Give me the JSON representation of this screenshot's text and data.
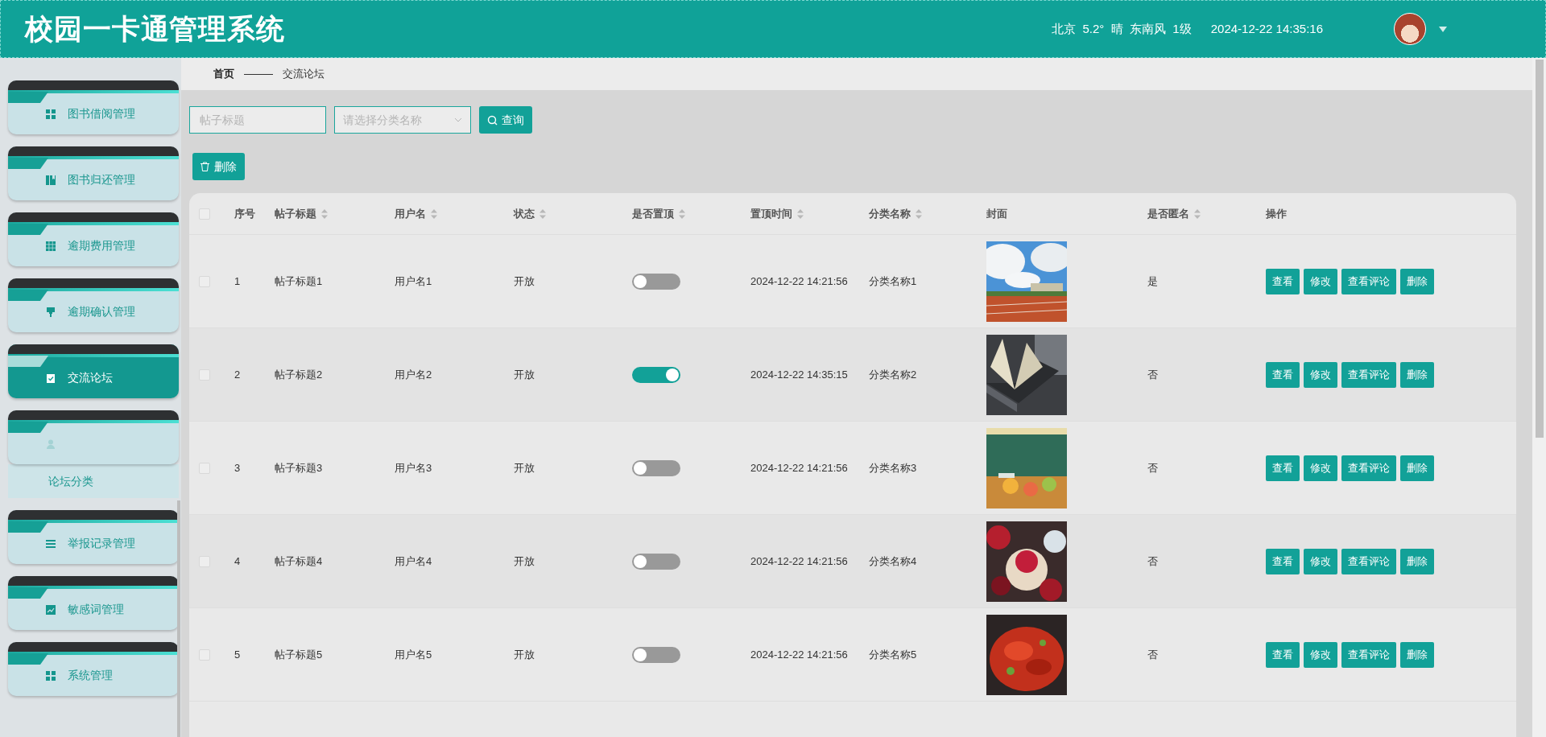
{
  "header": {
    "title": "校园一卡通管理系统",
    "weather": "北京  5.2°  晴  东南风  1级",
    "datetime": "2024-12-22 14:35:16"
  },
  "sidebar": {
    "items": [
      {
        "kind": "menu",
        "label": "图书借阅管理",
        "selected": false
      },
      {
        "kind": "menu",
        "label": "图书归还管理",
        "selected": false
      },
      {
        "kind": "menu",
        "label": "逾期费用管理",
        "selected": false
      },
      {
        "kind": "menu",
        "label": "逾期确认管理",
        "selected": false
      },
      {
        "kind": "menu",
        "label": "交流论坛",
        "selected": true
      },
      {
        "kind": "blank",
        "selected": false,
        "children": [
          {
            "label": "论坛分类"
          }
        ]
      },
      {
        "kind": "menu",
        "label": "举报记录管理",
        "selected": false
      },
      {
        "kind": "menu",
        "label": "敏感词管理",
        "selected": false
      },
      {
        "kind": "menu",
        "label": "系统管理",
        "selected": false
      }
    ]
  },
  "breadcrumb": [
    "首页",
    "交流论坛"
  ],
  "search": {
    "title_placeholder": "帖子标题",
    "category_placeholder": "请选择分类名称",
    "button": "查询"
  },
  "delete_button": "删除",
  "table": {
    "columns": [
      {
        "label": "序号",
        "sortable": false
      },
      {
        "label": "帖子标题",
        "sortable": true
      },
      {
        "label": "用户名",
        "sortable": true
      },
      {
        "label": "状态",
        "sortable": true
      },
      {
        "label": "是否置顶",
        "sortable": true
      },
      {
        "label": "置顶时间",
        "sortable": true
      },
      {
        "label": "分类名称",
        "sortable": true
      },
      {
        "label": "封面",
        "sortable": false
      },
      {
        "label": "是否匿名",
        "sortable": true
      },
      {
        "label": "操作",
        "sortable": false
      }
    ],
    "header_checked": false,
    "rows": [
      {
        "checked": false,
        "index": "1",
        "title": "帖子标题1",
        "user": "用户名1",
        "status": "开放",
        "pinned": false,
        "time": "2024-12-22 14:21:56",
        "category": "分类名称1",
        "cover": {
          "kind": "picture"
        },
        "anonymous": "是",
        "actions": [
          "查看",
          "修改",
          "查看评论",
          "删除"
        ]
      },
      {
        "checked": false,
        "index": "2",
        "title": "帖子标题2",
        "user": "用户名2",
        "status": "开放",
        "pinned": true,
        "time": "2024-12-22 14:35:15",
        "category": "分类名称2",
        "cover": {
          "kind": "picture"
        },
        "anonymous": "否",
        "actions": [
          "查看",
          "修改",
          "查看评论",
          "删除"
        ]
      },
      {
        "checked": false,
        "index": "3",
        "title": "帖子标题3",
        "user": "用户名3",
        "status": "开放",
        "pinned": false,
        "time": "2024-12-22 14:21:56",
        "category": "分类名称3",
        "cover": {
          "kind": "picture"
        },
        "anonymous": "否",
        "actions": [
          "查看",
          "修改",
          "查看评论",
          "删除"
        ]
      },
      {
        "checked": false,
        "index": "4",
        "title": "帖子标题4",
        "user": "用户名4",
        "status": "开放",
        "pinned": false,
        "time": "2024-12-22 14:21:56",
        "category": "分类名称4",
        "cover": {
          "kind": "picture"
        },
        "anonymous": "否",
        "actions": [
          "查看",
          "修改",
          "查看评论",
          "删除"
        ]
      },
      {
        "checked": false,
        "index": "5",
        "title": "帖子标题5",
        "user": "用户名5",
        "status": "开放",
        "pinned": false,
        "time": "2024-12-22 14:21:56",
        "category": "分类名称5",
        "cover": {
          "kind": "picture"
        },
        "anonymous": "否",
        "actions": [
          "查看",
          "修改",
          "查看评论",
          "删除"
        ]
      }
    ]
  }
}
